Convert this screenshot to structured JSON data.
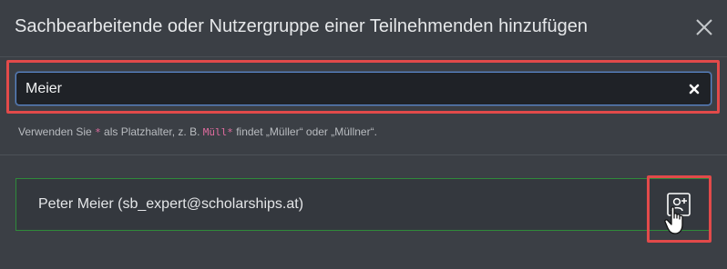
{
  "dialog": {
    "title": "Sachbearbeitende oder Nutzergruppe einer Teilnehmenden hinzufügen",
    "close_icon": "close-icon"
  },
  "search": {
    "value": "Meier",
    "clear_icon": "clear-icon"
  },
  "hint": {
    "part1": "Verwenden Sie ",
    "wildcard": "*",
    "part2": " als Platzhalter, z. B. ",
    "example": "Müll*",
    "part3": " findet „Müller“ oder „Müllner“."
  },
  "results": [
    {
      "label": "Peter Meier (sb_expert@scholarships.at)",
      "action_icon": "add-user-icon"
    }
  ],
  "colors": {
    "highlight": "#e24a4a",
    "result_border": "#2f8a3a",
    "input_border": "#5a86c9",
    "code_text": "#e06c9f"
  }
}
